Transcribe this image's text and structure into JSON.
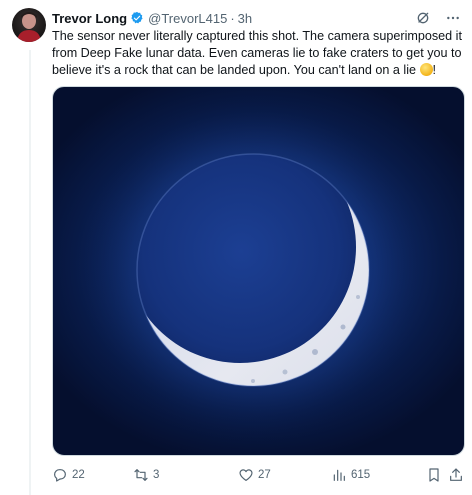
{
  "author": {
    "name": "Trevor Long",
    "handle": "@TrevorL415",
    "separator": "·",
    "time": "3h",
    "verified": true
  },
  "tweet": {
    "text": "The sensor never literally captured this shot. The camera superimposed it from Deep Fake lunar data. Even cameras lie to fake craters to get you to believe it's a rock that can be landed upon. You can't land on a lie ",
    "trailing": "!",
    "emoji": "thinking-face-emoji"
  },
  "media": {
    "subject": "crescent-moon-image"
  },
  "actions": {
    "replies": "22",
    "reposts": "3",
    "likes": "27",
    "views": "615"
  },
  "icons": {
    "grok": "grok-icon",
    "more": "more-icon",
    "reply": "reply-icon",
    "repost": "repost-icon",
    "like": "heart-icon",
    "views": "views-icon",
    "bookmark": "bookmark-icon",
    "share": "share-icon"
  },
  "colors": {
    "verified": "#1d9bf0",
    "text": "#0f1419",
    "muted": "#536471"
  }
}
